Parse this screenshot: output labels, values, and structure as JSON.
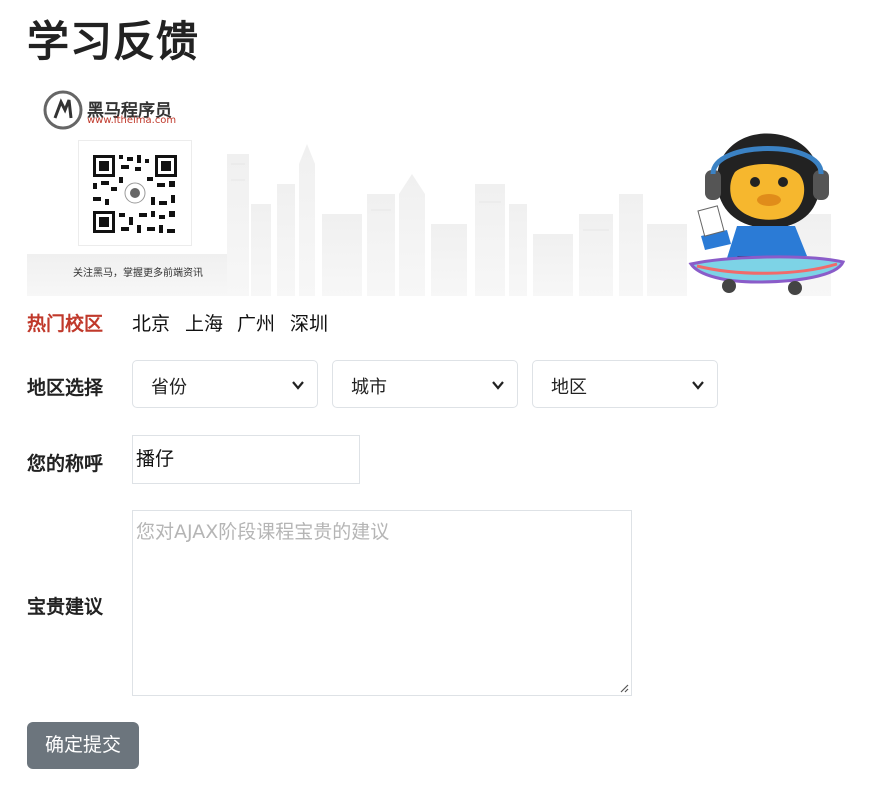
{
  "page": {
    "title": "学习反馈"
  },
  "banner": {
    "logo_name": "黑马程序员",
    "logo_url": "www.itheima.com",
    "qr_caption": "关注黑马，掌握更多前端资讯"
  },
  "hot_campus": {
    "label": "热门校区",
    "items": [
      "北京",
      "上海",
      "广州",
      "深圳"
    ]
  },
  "region": {
    "label": "地区选择",
    "province": "省份",
    "city": "城市",
    "area": "地区"
  },
  "nickname": {
    "label": "您的称呼",
    "value": "播仔"
  },
  "suggestion": {
    "label": "宝贵建议",
    "placeholder": "您对AJAX阶段课程宝贵的建议"
  },
  "submit": {
    "label": "确定提交"
  },
  "colors": {
    "accent_red": "#c0392b",
    "button_gray": "#6c757d",
    "border": "#dee2e6"
  }
}
